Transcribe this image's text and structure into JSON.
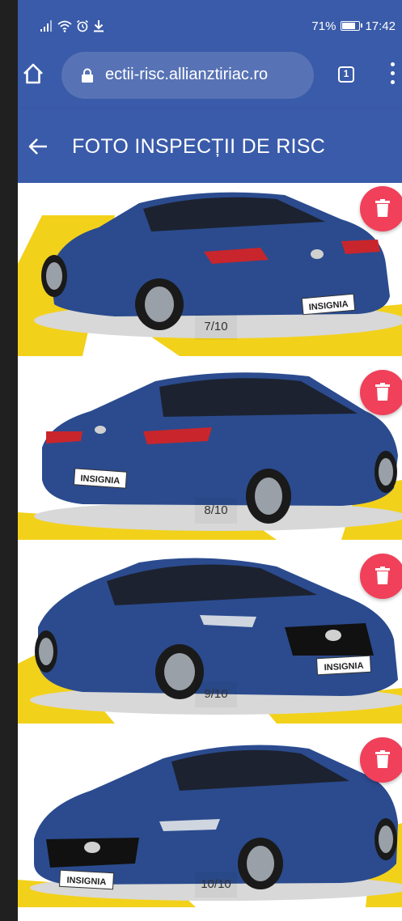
{
  "status_bar": {
    "battery": "71%",
    "battery_level": 0.71,
    "time": "17:42",
    "icons": [
      "signal-icon",
      "wifi-icon",
      "alarm-icon",
      "download-icon",
      "battery-icon"
    ]
  },
  "browser": {
    "url": "ectii-risc.allianztiriac.ro",
    "tab_count": "1",
    "icons": [
      "home-icon",
      "lock-icon",
      "menu-icon"
    ]
  },
  "header": {
    "title": "FOTO INSPECȚII DE RISC",
    "back_icon": "arrow-left-icon"
  },
  "photos": [
    {
      "counter": "7/10",
      "badge": "INSIGNIA",
      "view": "rear-three-quarter-right"
    },
    {
      "counter": "8/10",
      "badge": "INSIGNIA",
      "view": "rear-three-quarter-left"
    },
    {
      "counter": "9/10",
      "badge": "INSIGNIA",
      "view": "front-three-quarter-right"
    },
    {
      "counter": "10/10",
      "badge": "INSIGNIA",
      "view": "front-three-quarter-left"
    }
  ],
  "delete_icon": "trash-icon",
  "colors": {
    "app_bar": "#3a5ba9",
    "url_pill": "#5873b5",
    "delete": "#f0405a",
    "car_body": "#2b4b8e",
    "floor_yellow": "#f2d11b"
  }
}
